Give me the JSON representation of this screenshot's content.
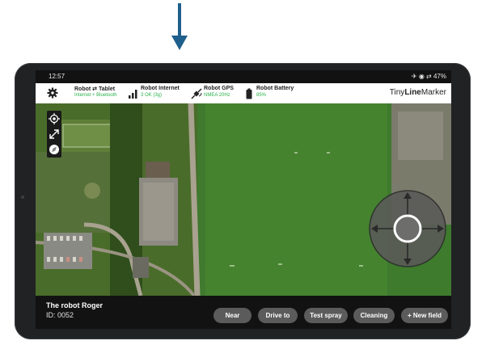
{
  "status_bar": {
    "time": "12:57",
    "system_icons": "✈ ◉ ⇄ 47%"
  },
  "app_bar": {
    "settings_icon": "gear-icon",
    "stats": [
      {
        "title": "Robot ⇄ Tablet",
        "subtitle": "Internet + Bluetooth",
        "icon": "link-icon"
      },
      {
        "title": "Robot Internet",
        "subtitle": "3 OK (3g)",
        "icon": "signal-bars-icon"
      },
      {
        "title": "Robot GPS",
        "subtitle": "NMEA 20Hz",
        "icon": "satellite-icon"
      },
      {
        "title": "Robot Battery",
        "subtitle": "85%",
        "icon": "battery-icon"
      }
    ],
    "brand": {
      "prefix": "Tiny",
      "bold": "Line",
      "suffix": "Marker"
    }
  },
  "map_tools": [
    "locate-icon",
    "expand-icon",
    "compass-icon"
  ],
  "joystick": {
    "icon": "joystick-icon"
  },
  "robot": {
    "name": "The robot Roger",
    "id": "ID: 0052"
  },
  "actions": [
    "Near",
    "Drive to",
    "Test spray",
    "Cleaning",
    "+ New field"
  ],
  "colors": {
    "accent_green": "#2bb24c",
    "arrow_blue": "#1f5f8b",
    "button_bg": "#5b5b5b"
  }
}
